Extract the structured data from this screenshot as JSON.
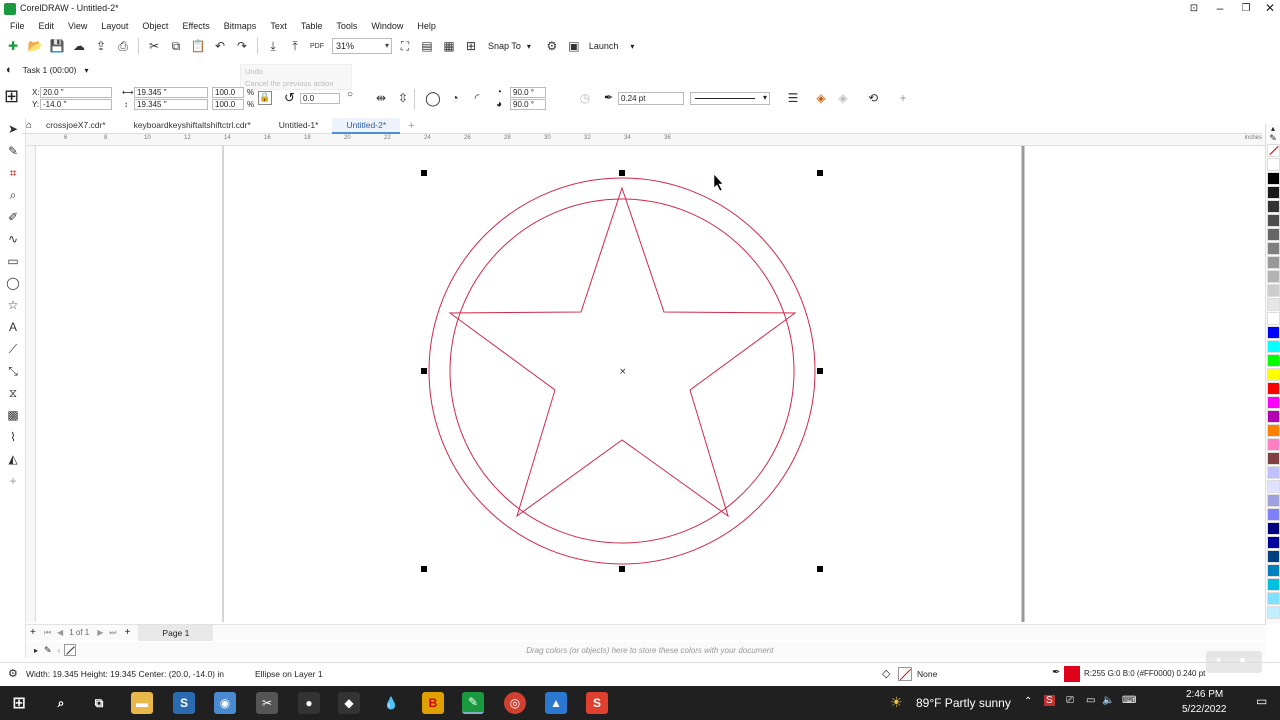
{
  "window": {
    "title": "CorelDRAW - Untitled-2*"
  },
  "menu": [
    "File",
    "Edit",
    "View",
    "Layout",
    "Object",
    "Effects",
    "Bitmaps",
    "Text",
    "Table",
    "Tools",
    "Window",
    "Help"
  ],
  "toolbar": {
    "zoom": "31%",
    "snap_to": "Snap To",
    "launch": "Launch",
    "tooltip_title": "Undo",
    "tooltip_desc": "Cancel the previous action",
    "pdf_label": "PDF"
  },
  "task": {
    "label": "Task 1 (00:00)"
  },
  "property_bar": {
    "x": "20.0 \"",
    "y": "-14.0 \"",
    "x_label": "X:",
    "y_label": "Y:",
    "width": "19.345 \"",
    "height": "19.345 \"",
    "scale_w": "100.0",
    "scale_h": "100.0",
    "percent": "%",
    "rotation": "0.0",
    "start_angle": "90.0 °",
    "end_angle": "90.0 °",
    "outline_width": "0.24 pt"
  },
  "tabs": [
    {
      "label": "crossjoeX7.cdr*"
    },
    {
      "label": "keyboardkeyshiftaltshiftctrl.cdr*"
    },
    {
      "label": "Untitled-1*"
    },
    {
      "label": "Untitled-2*"
    }
  ],
  "ruler": {
    "unit": "inches",
    "ticks": [
      "6",
      "8",
      "10",
      "12",
      "14",
      "16",
      "18",
      "20",
      "22",
      "24",
      "26",
      "28",
      "30",
      "32",
      "34",
      "36"
    ]
  },
  "page_nav": {
    "counter": "1 of 1",
    "page_tab": "Page 1"
  },
  "document_palette": {
    "hint": "Drag colors (or objects) here to store these colors with your document"
  },
  "status": {
    "dimensions": "Width: 19.345  Height: 19.345  Center: (20.0, -14.0)  in",
    "selection": "Ellipse on Layer 1",
    "fill": "None",
    "outline": "R:255 G:0 B:0 (#FF0000)  0.240 pt",
    "outline_color": "#E0001B"
  },
  "palette_colors": [
    "#ffffff",
    "#000000",
    "#1a1a1a",
    "#333333",
    "#4d4d4d",
    "#666666",
    "#808080",
    "#999999",
    "#b3b3b3",
    "#cccccc",
    "#e6e6e6",
    "#ffffff",
    "#0000ff",
    "#00ffff",
    "#00ff00",
    "#ffff00",
    "#ff0000",
    "#ff00ff",
    "#b300b3",
    "#ff8000",
    "#ff80c0",
    "#804040",
    "#c0c0ff",
    "#e0e0ff",
    "#a0a0e0",
    "#8080ff",
    "#000080",
    "#0000a0",
    "#004080",
    "#0080c0",
    "#00c0e0",
    "#80e0ff",
    "#c0f0ff"
  ],
  "taskbar": {
    "weather": "89°F  Partly sunny",
    "time": "2:46 PM",
    "date": "5/22/2022",
    "apps": [
      "start",
      "search",
      "task-view",
      "file-explorer",
      "app-s-blue",
      "app-palette",
      "app-snipping",
      "app-camera",
      "app-drop",
      "app-b",
      "coreldraw",
      "chrome",
      "photos",
      "app-s-red"
    ]
  }
}
